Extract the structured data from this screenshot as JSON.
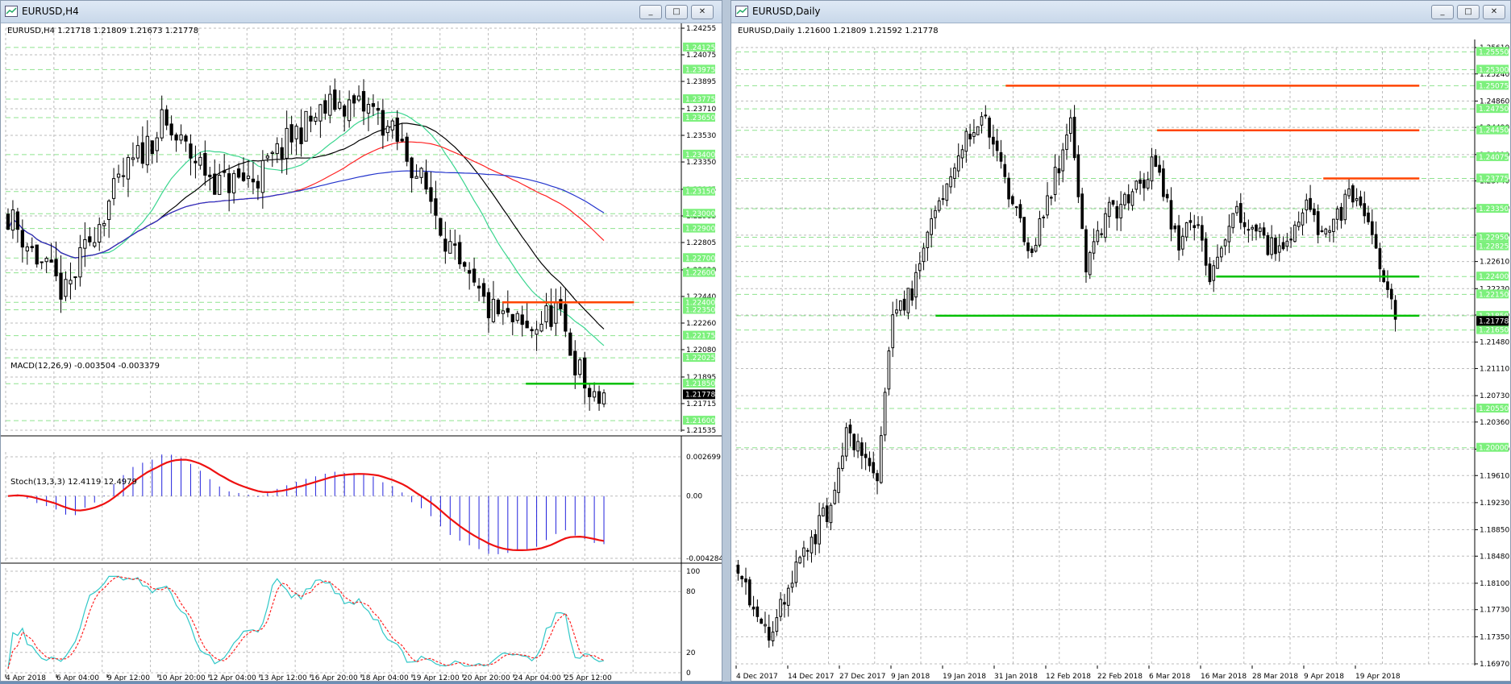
{
  "colors": {
    "bull": "#ffffff",
    "bear": "#000000",
    "resistance": "#ff4500",
    "support": "#00c000",
    "ma_black": "#000000",
    "ma_green": "#3cd690",
    "ma_red": "#ff2222",
    "ma_blue": "#2233cc",
    "macd_hist": "#2222dd",
    "macd_signal": "#ee1111",
    "stoch_main": "#30c8c8",
    "stoch_signal": "#ff2222",
    "label_green_bg": "#7cf07c",
    "label_black_bg": "#000000"
  },
  "left_window": {
    "title": "EURUSD,H4",
    "buttons": {
      "minimize": "_",
      "maximize": "□",
      "close": "✕"
    },
    "info": "EURUSD,H4  1.21718 1.21809 1.21673 1.21778",
    "price_axis": {
      "ymin": 1.21535,
      "ymax": 1.24255,
      "ticks": [
        "1.24255",
        "1.24075",
        "1.23895",
        "1.23710",
        "1.23530",
        "1.23350",
        "1.23165",
        "1.22985",
        "1.22805",
        "1.22620",
        "1.22440",
        "1.22260",
        "1.22080",
        "1.21895",
        "1.21715",
        "1.21535"
      ],
      "green_labels": [
        "1.24125",
        "1.23975",
        "1.23775",
        "1.23650",
        "1.23400",
        "1.23150",
        "1.23000",
        "1.22900",
        "1.22700",
        "1.22600",
        "1.22400",
        "1.22350",
        "1.22175",
        "1.22025",
        "1.21850",
        "1.21600"
      ],
      "current": "1.21778"
    },
    "levels": [
      {
        "type": "resistance",
        "price": 1.224,
        "x_start": 0.735,
        "x_end": 0.93
      },
      {
        "type": "support",
        "price": 1.2185,
        "x_start": 0.77,
        "x_end": 0.93
      }
    ],
    "macd": {
      "title": "MACD(12,26,9) -0.003504 -0.003379",
      "ticks": [
        "0.002699",
        "0.00",
        "-0.004284"
      ],
      "min": -0.004284,
      "max": 0.002699
    },
    "stoch": {
      "title": "Stoch(13,3,3) 12.4119 12.4979",
      "ticks": [
        "100",
        "80",
        "20",
        "0"
      ]
    },
    "time_labels": [
      "4 Apr 2018",
      "6 Apr 04:00",
      "9 Apr 12:00",
      "10 Apr 20:00",
      "12 Apr 04:00",
      "13 Apr 12:00",
      "16 Apr 20:00",
      "18 Apr 04:00",
      "19 Apr 12:00",
      "20 Apr 20:00",
      "24 Apr 04:00",
      "25 Apr 12:00"
    ]
  },
  "right_window": {
    "title": "EURUSD,Daily",
    "buttons": {
      "minimize": "_",
      "maximize": "□",
      "close": "✕"
    },
    "info": "EURUSD,Daily  1.21600 1.21809 1.21592 1.21778",
    "price_axis": {
      "ymin": 1.1697,
      "ymax": 1.2561,
      "ticks": [
        "1.25610",
        "1.25240",
        "1.24860",
        "1.24490",
        "1.24110",
        "1.23740",
        "1.23360",
        "1.22980",
        "1.22610",
        "1.22230",
        "1.21860",
        "1.21480",
        "1.21110",
        "1.20730",
        "1.20360",
        "1.19980",
        "1.19610",
        "1.19230",
        "1.18850",
        "1.18480",
        "1.18100",
        "1.17730",
        "1.17350",
        "1.16970"
      ],
      "green_labels": [
        "1.25550",
        "1.25300",
        "1.25075",
        "1.24750",
        "1.24450",
        "1.24075",
        "1.23775",
        "1.23350",
        "1.22950",
        "1.22825",
        "1.22400",
        "1.22150",
        "1.21850",
        "1.21650",
        "1.20550",
        "1.20000"
      ],
      "current": "1.21778"
    },
    "levels": [
      {
        "type": "resistance",
        "price": 1.25075,
        "x_start": 0.365,
        "x_end": 0.925
      },
      {
        "type": "resistance",
        "price": 1.2445,
        "x_start": 0.57,
        "x_end": 0.925
      },
      {
        "type": "resistance",
        "price": 1.23775,
        "x_start": 0.795,
        "x_end": 0.925
      },
      {
        "type": "support",
        "price": 1.224,
        "x_start": 0.65,
        "x_end": 0.925
      },
      {
        "type": "support",
        "price": 1.2185,
        "x_start": 0.27,
        "x_end": 0.925
      }
    ],
    "time_labels": [
      "4 Dec 2017",
      "14 Dec 2017",
      "27 Dec 2017",
      "9 Jan 2018",
      "19 Jan 2018",
      "31 Jan 2018",
      "12 Feb 2018",
      "22 Feb 2018",
      "6 Mar 2018",
      "16 Mar 2018",
      "28 Mar 2018",
      "9 Apr 2018",
      "19 Apr 2018"
    ]
  }
}
